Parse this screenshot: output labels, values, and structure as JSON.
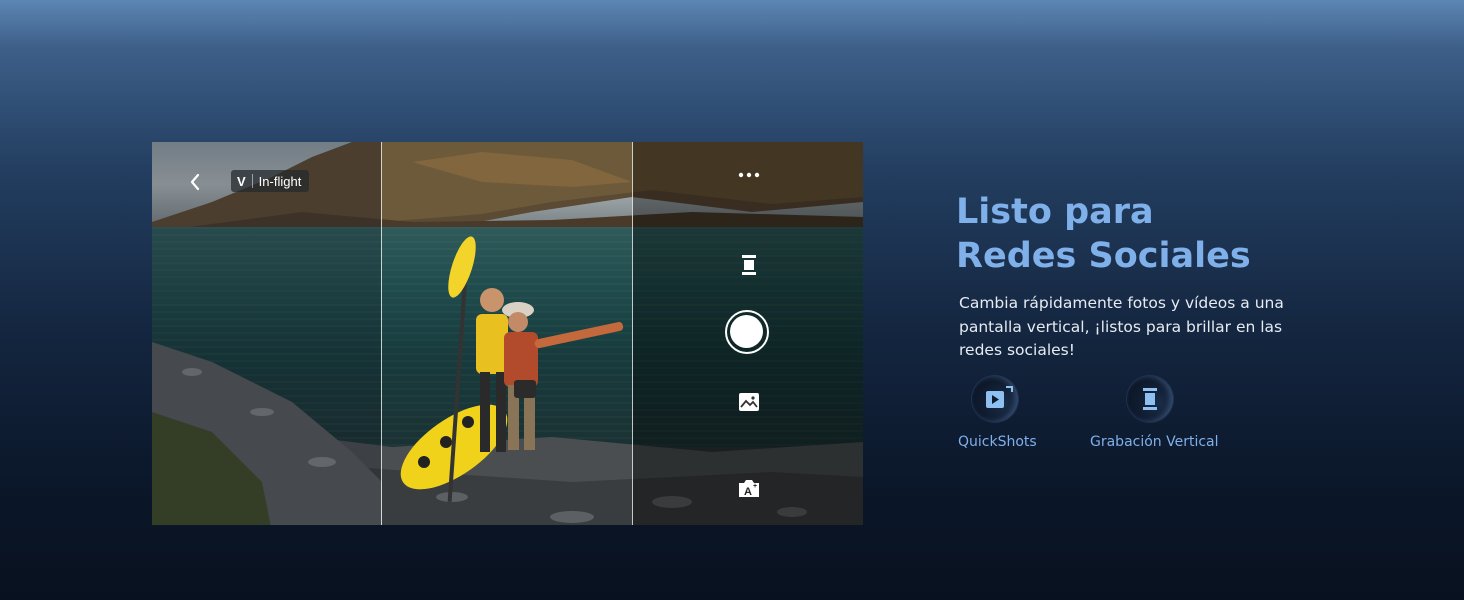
{
  "ui": {
    "mode_letter": "V",
    "mode_label": "In-flight"
  },
  "heading": {
    "line1": "Listo para",
    "line2": "Redes Sociales"
  },
  "description": "Cambia rápidamente fotos y vídeos a una pantalla vertical, ¡listos para brillar en las redes sociales!",
  "features": [
    {
      "label": "QuickShots",
      "icon": "quickshots-icon"
    },
    {
      "label": "Grabación Vertical",
      "icon": "vertical-recording-icon"
    }
  ],
  "colors": {
    "accent": "#7fb0ea",
    "background_top": "#5d86b4",
    "background_bottom": "#08111f"
  }
}
